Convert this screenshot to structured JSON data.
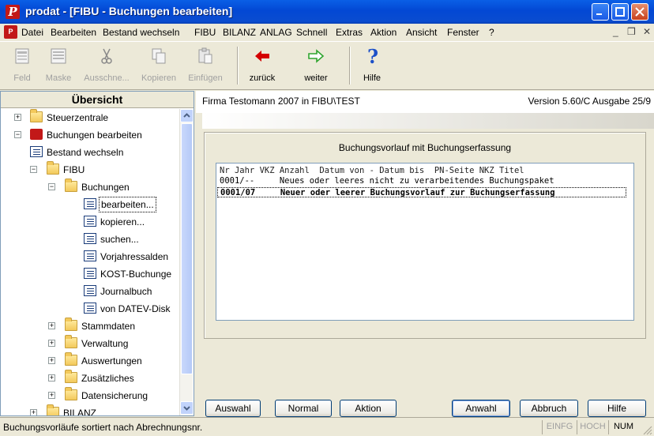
{
  "window": {
    "title": "prodat - [FIBU - Buchungen bearbeiten]",
    "app_icon_letter": "P"
  },
  "menu": {
    "items": [
      "Datei",
      "Bearbeiten",
      "Bestand wechseln",
      "FIBU",
      "BILANZ",
      "ANLAG",
      "Schnell",
      "Extras",
      "Aktion",
      "Ansicht",
      "Fenster",
      "?"
    ],
    "mdi_controls": [
      "_",
      "❒",
      "✕"
    ]
  },
  "toolbar": {
    "items": [
      {
        "label": "Feld",
        "icon": "field-icon",
        "enabled": false
      },
      {
        "label": "Maske",
        "icon": "mask-icon",
        "enabled": false
      },
      {
        "label": "Ausschne...",
        "icon": "scissors-icon",
        "enabled": false
      },
      {
        "label": "Kopieren",
        "icon": "copy-icon",
        "enabled": false
      },
      {
        "label": "Einfügen",
        "icon": "paste-icon",
        "enabled": false
      },
      {
        "label": "zurück",
        "icon": "arrow-left-icon",
        "enabled": true
      },
      {
        "label": "weiter",
        "icon": "arrow-right-icon",
        "enabled": true
      },
      {
        "label": "Hilfe",
        "icon": "help-icon",
        "enabled": true
      }
    ]
  },
  "sidebar": {
    "header": "Übersicht",
    "tree": [
      {
        "label": "Steuerzentrale",
        "icon": "folder-icon",
        "expander": "+"
      },
      {
        "label": "Buchungen bearbeiten",
        "icon": "app-icon",
        "expander": "−"
      },
      {
        "label": "Bestand wechseln",
        "icon": "document-icon",
        "expander": ""
      },
      {
        "label": "FIBU",
        "icon": "folder-icon",
        "expander": "−"
      },
      {
        "label": "Buchungen",
        "icon": "folder-icon",
        "expander": "−"
      },
      {
        "label": "bearbeiten...",
        "icon": "document-icon",
        "expander": "",
        "selected": true
      },
      {
        "label": "kopieren...",
        "icon": "document-icon",
        "expander": ""
      },
      {
        "label": "suchen...",
        "icon": "document-icon",
        "expander": ""
      },
      {
        "label": "Vorjahressalden",
        "icon": "document-icon",
        "expander": ""
      },
      {
        "label": "KOST-Buchunge",
        "icon": "document-icon",
        "expander": ""
      },
      {
        "label": "Journalbuch",
        "icon": "document-icon",
        "expander": ""
      },
      {
        "label": "von DATEV-Disk",
        "icon": "document-icon",
        "expander": ""
      },
      {
        "label": "Stammdaten",
        "icon": "folder-icon",
        "expander": "+"
      },
      {
        "label": "Verwaltung",
        "icon": "folder-icon",
        "expander": "+"
      },
      {
        "label": "Auswertungen",
        "icon": "folder-icon",
        "expander": "+"
      },
      {
        "label": "Zusätzliches",
        "icon": "folder-icon",
        "expander": "+"
      },
      {
        "label": "Datensicherung",
        "icon": "folder-icon",
        "expander": "+"
      },
      {
        "label": "BILANZ",
        "icon": "folder-icon",
        "expander": "+"
      }
    ]
  },
  "main": {
    "company": "Firma Testomann 2007 in FIBU\\TEST",
    "version": "Version 5.60/C Ausgabe 25/9",
    "panel_title": "Buchungsvorlauf mit Buchungserfassung",
    "list_header": "Nr Jahr VKZ Anzahl  Datum von - Datum bis  PN-Seite NKZ Titel",
    "list_rows": [
      "0001/--     Neues oder leeres nicht zu verarbeitendes Buchungspaket",
      "0001/07     Neuer oder leerer Buchungsvorlauf zur Buchungserfassung"
    ],
    "buttons": {
      "auswahl_left": "Auswahl",
      "normal": "Normal",
      "aktion": "Aktion",
      "anwahl": "Anwahl",
      "abbruch": "Abbruch",
      "hilfe": "Hilfe"
    }
  },
  "status": {
    "message": "Buchungsvorläufe sortiert nach Abrechnungsnr.",
    "indicators": [
      {
        "label": "EINFG",
        "active": false
      },
      {
        "label": "HOCH",
        "active": false
      },
      {
        "label": "NUM",
        "active": true
      }
    ]
  },
  "colors": {
    "titlebar": "#0348d4",
    "app_icon": "#c21818",
    "arrow_left": "#d40000",
    "arrow_right": "#2fa52f",
    "help": "#1c50c8"
  }
}
